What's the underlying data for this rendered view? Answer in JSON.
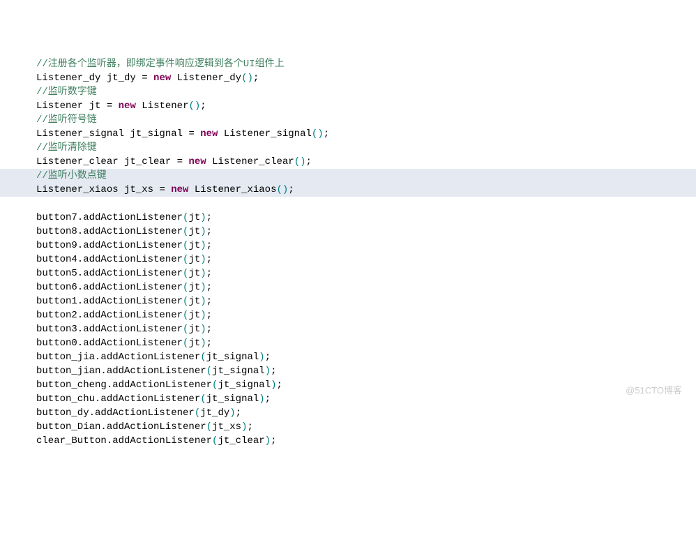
{
  "lines": [
    {
      "c": "//注册各个监听器，即绑定事件响应逻辑到各个UI组件上",
      "type": "comment"
    },
    {
      "tokens": [
        "Listener_dy jt_dy ",
        "=",
        " ",
        "new",
        " Listener_dy",
        "(",
        ")",
        ";"
      ],
      "types": [
        "text",
        "text",
        "text",
        "keyword",
        "text",
        "bracket-teal",
        "bracket-teal",
        "text"
      ]
    },
    {
      "c": "//监听数字键",
      "type": "comment"
    },
    {
      "tokens": [
        "Listener jt ",
        "=",
        " ",
        "new",
        " Listener",
        "(",
        ")",
        ";"
      ],
      "types": [
        "text",
        "text",
        "text",
        "keyword",
        "text",
        "bracket-teal",
        "bracket-teal",
        "text"
      ]
    },
    {
      "c": "//监听符号链",
      "type": "comment"
    },
    {
      "tokens": [
        "Listener_signal jt_signal ",
        "=",
        " ",
        "new",
        " Listener_signal",
        "(",
        ")",
        ";"
      ],
      "types": [
        "text",
        "text",
        "text",
        "keyword",
        "text",
        "bracket-teal",
        "bracket-teal",
        "text"
      ]
    },
    {
      "c": "//监听清除键",
      "type": "comment"
    },
    {
      "tokens": [
        "Listener_clear jt_clear ",
        "=",
        " ",
        "new",
        " Listener_clear",
        "(",
        ")",
        ";"
      ],
      "types": [
        "text",
        "text",
        "text",
        "keyword",
        "text",
        "bracket-teal",
        "bracket-teal",
        "text"
      ]
    },
    {
      "c": "//监听小数点键",
      "type": "comment",
      "highlighted": true
    },
    {
      "tokens": [
        "Listener_xiaos jt_xs ",
        "=",
        " ",
        "new",
        " Listener_xiaos",
        "(",
        ")",
        ";"
      ],
      "types": [
        "text",
        "text",
        "text",
        "keyword",
        "text",
        "bracket-teal",
        "bracket-teal",
        "text"
      ],
      "highlighted": true
    },
    {
      "blank": true
    },
    {
      "tokens": [
        "button7.addActionListener",
        "(",
        "jt",
        ")",
        ";"
      ],
      "types": [
        "text",
        "bracket-teal",
        "text",
        "bracket-teal",
        "text"
      ]
    },
    {
      "tokens": [
        "button8.addActionListener",
        "(",
        "jt",
        ")",
        ";"
      ],
      "types": [
        "text",
        "bracket-teal",
        "text",
        "bracket-teal",
        "text"
      ]
    },
    {
      "tokens": [
        "button9.addActionListener",
        "(",
        "jt",
        ")",
        ";"
      ],
      "types": [
        "text",
        "bracket-teal",
        "text",
        "bracket-teal",
        "text"
      ]
    },
    {
      "tokens": [
        "button4.addActionListener",
        "(",
        "jt",
        ")",
        ";"
      ],
      "types": [
        "text",
        "bracket-teal",
        "text",
        "bracket-teal",
        "text"
      ]
    },
    {
      "tokens": [
        "button5.addActionListener",
        "(",
        "jt",
        ")",
        ";"
      ],
      "types": [
        "text",
        "bracket-teal",
        "text",
        "bracket-teal",
        "text"
      ]
    },
    {
      "tokens": [
        "button6.addActionListener",
        "(",
        "jt",
        ")",
        ";"
      ],
      "types": [
        "text",
        "bracket-teal",
        "text",
        "bracket-teal",
        "text"
      ]
    },
    {
      "tokens": [
        "button1.addActionListener",
        "(",
        "jt",
        ")",
        ";"
      ],
      "types": [
        "text",
        "bracket-teal",
        "text",
        "bracket-teal",
        "text"
      ]
    },
    {
      "tokens": [
        "button2.addActionListener",
        "(",
        "jt",
        ")",
        ";"
      ],
      "types": [
        "text",
        "bracket-teal",
        "text",
        "bracket-teal",
        "text"
      ]
    },
    {
      "tokens": [
        "button3.addActionListener",
        "(",
        "jt",
        ")",
        ";"
      ],
      "types": [
        "text",
        "bracket-teal",
        "text",
        "bracket-teal",
        "text"
      ]
    },
    {
      "tokens": [
        "button0.addActionListener",
        "(",
        "jt",
        ")",
        ";"
      ],
      "types": [
        "text",
        "bracket-teal",
        "text",
        "bracket-teal",
        "text"
      ]
    },
    {
      "tokens": [
        "button_jia.addActionListener",
        "(",
        "jt_signal",
        ")",
        ";"
      ],
      "types": [
        "text",
        "bracket-teal",
        "text",
        "bracket-teal",
        "text"
      ]
    },
    {
      "tokens": [
        "button_jian.addActionListener",
        "(",
        "jt_signal",
        ")",
        ";"
      ],
      "types": [
        "text",
        "bracket-teal",
        "text",
        "bracket-teal",
        "text"
      ]
    },
    {
      "tokens": [
        "button_cheng.addActionListener",
        "(",
        "jt_signal",
        ")",
        ";"
      ],
      "types": [
        "text",
        "bracket-teal",
        "text",
        "bracket-teal",
        "text"
      ]
    },
    {
      "tokens": [
        "button_chu.addActionListener",
        "(",
        "jt_signal",
        ")",
        ";"
      ],
      "types": [
        "text",
        "bracket-teal",
        "text",
        "bracket-teal",
        "text"
      ]
    },
    {
      "tokens": [
        "button_dy.addActionListener",
        "(",
        "jt_dy",
        ")",
        ";"
      ],
      "types": [
        "text",
        "bracket-teal",
        "text",
        "bracket-teal",
        "text"
      ]
    },
    {
      "tokens": [
        "button_Dian.addActionListener",
        "(",
        "jt_xs",
        ")",
        ";"
      ],
      "types": [
        "text",
        "bracket-teal",
        "text",
        "bracket-teal",
        "text"
      ]
    },
    {
      "tokens": [
        "clear_Button.addActionListener",
        "(",
        "jt_clear",
        ")",
        ";"
      ],
      "types": [
        "text",
        "bracket-teal",
        "text",
        "bracket-teal",
        "text"
      ]
    }
  ],
  "watermark": "@51CTO博客"
}
